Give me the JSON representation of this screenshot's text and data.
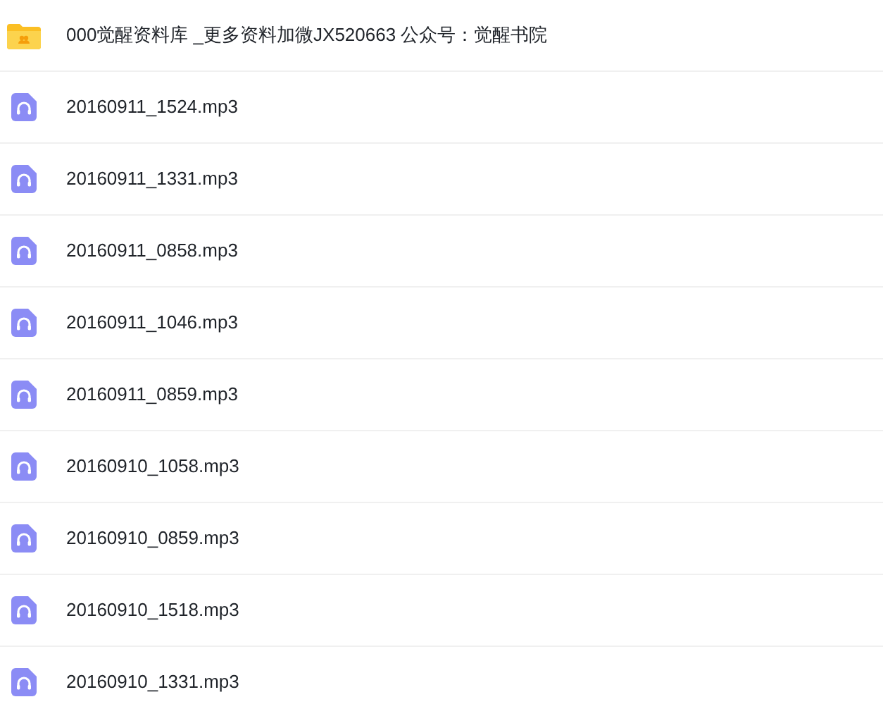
{
  "files": [
    {
      "kind": "folder",
      "name": "000觉醒资料库 _更多资料加微JX520663 公众号：觉醒书院"
    },
    {
      "kind": "audio",
      "name": "20160911_1524.mp3"
    },
    {
      "kind": "audio",
      "name": "20160911_1331.mp3"
    },
    {
      "kind": "audio",
      "name": "20160911_0858.mp3"
    },
    {
      "kind": "audio",
      "name": "20160911_1046.mp3"
    },
    {
      "kind": "audio",
      "name": "20160911_0859.mp3"
    },
    {
      "kind": "audio",
      "name": "20160910_1058.mp3"
    },
    {
      "kind": "audio",
      "name": "20160910_0859.mp3"
    },
    {
      "kind": "audio",
      "name": "20160910_1518.mp3"
    },
    {
      "kind": "audio",
      "name": "20160910_1331.mp3"
    }
  ]
}
